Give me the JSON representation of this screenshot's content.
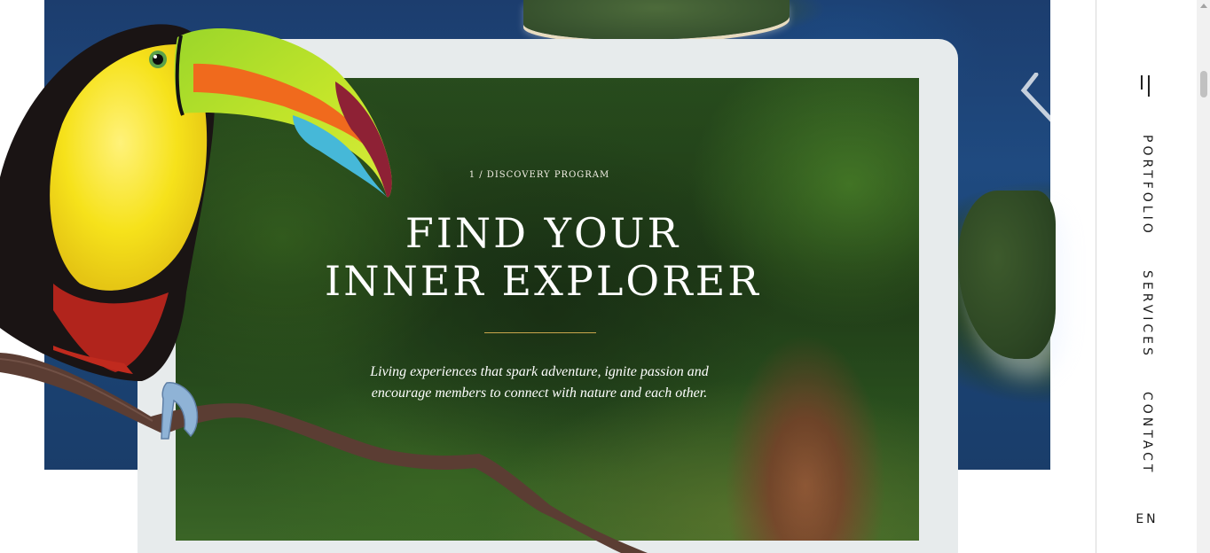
{
  "hero": {
    "eyebrow": "1 / DISCOVERY PROGRAM",
    "title_line1": "FIND YOUR",
    "title_line2": "INNER EXPLORER",
    "description": "Living experiences that spark adventure, ignite passion and encourage members to connect with nature and each other."
  },
  "nav": {
    "menu_icon": "menu-icon",
    "links": [
      "PORTFOLIO",
      "SERVICES",
      "CONTACT"
    ],
    "language": "EN"
  },
  "colors": {
    "accent_rule": "#c9a64c",
    "card_frame": "#e7ebec",
    "ocean": "#1f4a80"
  }
}
